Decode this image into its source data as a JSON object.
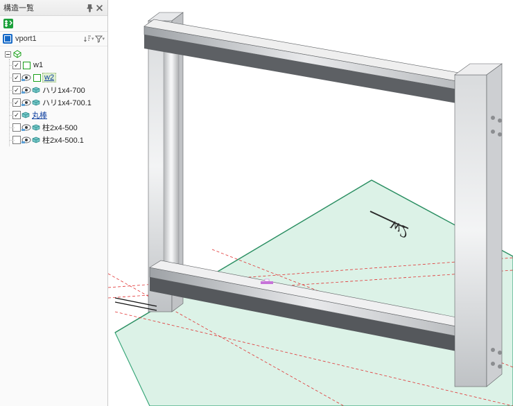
{
  "panel": {
    "title": "構造一覧",
    "viewport_name": "vport1",
    "root_color": "#18a018"
  },
  "tree": [
    {
      "label": "w1",
      "checked": true,
      "has_eye": false,
      "icon": "plane",
      "selected": false,
      "highlight": false
    },
    {
      "label": "w2",
      "checked": true,
      "has_eye": true,
      "icon": "plane",
      "selected": true,
      "highlight": true
    },
    {
      "label": "ハリ1x4-700",
      "checked": true,
      "has_eye": true,
      "icon": "part",
      "selected": false,
      "highlight": false
    },
    {
      "label": "ハリ1x4-700.1",
      "checked": true,
      "has_eye": true,
      "icon": "part",
      "selected": false,
      "highlight": false
    },
    {
      "label": "丸棒",
      "checked": true,
      "has_eye": false,
      "icon": "part",
      "selected": true,
      "highlight": false
    },
    {
      "label": "柱2x4-500",
      "checked": false,
      "has_eye": true,
      "icon": "part",
      "selected": false,
      "highlight": false
    },
    {
      "label": "柱2x4-500.1",
      "checked": false,
      "has_eye": true,
      "icon": "part",
      "selected": false,
      "highlight": false
    }
  ],
  "scene": {
    "sketch_plane_label": "w2"
  }
}
